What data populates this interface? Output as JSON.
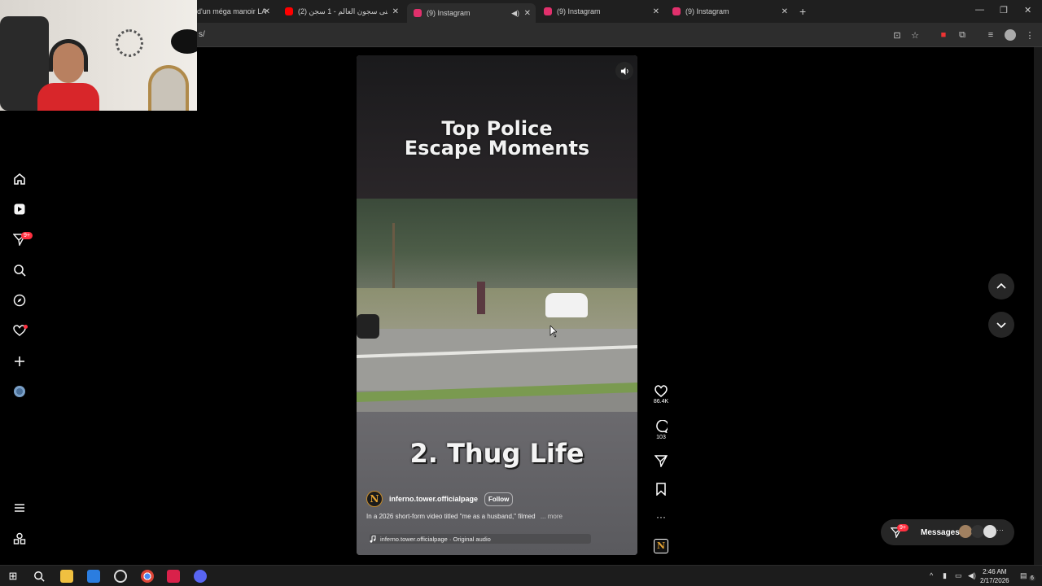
{
  "browser": {
    "tabs": [
      {
        "label": "d'un méga manoir LA",
        "favicon_color": "#1f1f1f"
      },
      {
        "label": "(2) أغنى سجون العالم - 1 سجن ...",
        "favicon_color": "#ff0000"
      },
      {
        "label": "(9) Instagram",
        "favicon_color": "#e1306c",
        "active": true
      },
      {
        "label": "(9) Instagram",
        "favicon_color": "#e1306c"
      },
      {
        "label": "(9) Instagram",
        "favicon_color": "#e1306c"
      }
    ],
    "new_tab": "+",
    "url": "s/",
    "window_controls": [
      "—",
      "❐",
      "✕"
    ]
  },
  "sidebar": {
    "icons": [
      "home-icon",
      "reels-icon",
      "messages-icon",
      "search-icon",
      "explore-icon",
      "notifications-icon",
      "create-icon",
      "profile-icon"
    ],
    "messages_badge": "9+",
    "bottom_icons": [
      "menu-icon",
      "also-from-meta-icon"
    ]
  },
  "reel": {
    "title_line1": "Top Police",
    "title_line2": "Escape Moments",
    "overlay_text": "2. Thug Life",
    "author": "inferno.tower.officialpage",
    "avatar_letter": "N",
    "follow_label": "Follow",
    "caption": "In a 2026 short-form video titled \"me as a husband,\" filmed",
    "more_label": "... more",
    "audio": "inferno.tower.officialpage · Original audio"
  },
  "actions": {
    "likes": "86.4K",
    "comments": "103"
  },
  "messages": {
    "label": "Messages",
    "badge": "9+"
  },
  "taskbar": {
    "time": "2:46 AM",
    "date": "2/17/2026",
    "notification_count": "6"
  },
  "colors": {
    "instagram_red": "#ff3040",
    "avatar_gold": "#e5a333",
    "background": "#000000"
  }
}
